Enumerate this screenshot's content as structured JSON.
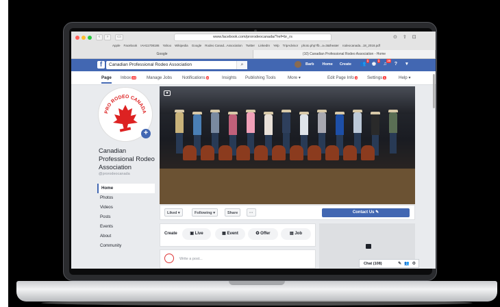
{
  "browser": {
    "url": "www.facebook.com/prorodeocanada/?ref=br_rs",
    "bookmarks": [
      "Apple",
      "Facebook",
      "IAH11708186",
      "Yahoo",
      "Wikipedia",
      "Google",
      "Rodeo Canad...Association",
      "Twitter",
      "LinkedIn",
      "Yelp",
      "TripAdvisor",
      "photo.php?fb...a=3&theater",
      "rodeocanada...18_2018.pdf"
    ],
    "tabs": [
      {
        "label": "Google",
        "active": false
      },
      {
        "label": "(10) Canadian Professional Rodeo Association - Home",
        "active": true
      }
    ]
  },
  "fb": {
    "search_value": "Canadian Professional Rodeo Association",
    "user": "Barb",
    "home": "Home",
    "create": "Create",
    "badges": {
      "friends": "1",
      "messages": "1",
      "notifications": "20"
    }
  },
  "pagenav": {
    "items": [
      {
        "label": "Page"
      },
      {
        "label": "Inbox",
        "badge": "43"
      },
      {
        "label": "Manage Jobs"
      },
      {
        "label": "Notifications",
        "badge": "4"
      },
      {
        "label": "Insights"
      },
      {
        "label": "Publishing Tools"
      },
      {
        "label": "More ▾"
      }
    ],
    "right": [
      {
        "label": "Edit Page Info",
        "badge": "1"
      },
      {
        "label": "Settings",
        "badge": "1"
      },
      {
        "label": "Help ▾"
      }
    ]
  },
  "profile": {
    "logo_text": "PRO RODEO CANADA",
    "name": "Canadian Professional Rodeo Association",
    "handle": "@prorodeocanada"
  },
  "leftnav": [
    "Home",
    "Photos",
    "Videos",
    "Posts",
    "Events",
    "About",
    "Community"
  ],
  "actions": {
    "liked": "Liked ▾",
    "following": "Following ▾",
    "share": "Share",
    "more": "···",
    "contact": "Contact Us ✎"
  },
  "create": {
    "label": "Create",
    "buttons": [
      "Live",
      "Event",
      "Offer",
      "Job"
    ],
    "post_placeholder": "Write a post..."
  },
  "chat": {
    "label": "Chat (108)"
  },
  "colors": {
    "fb_blue": "#4267b2",
    "badge_red": "#fa3e3e",
    "page_bg": "#e9ebee"
  }
}
